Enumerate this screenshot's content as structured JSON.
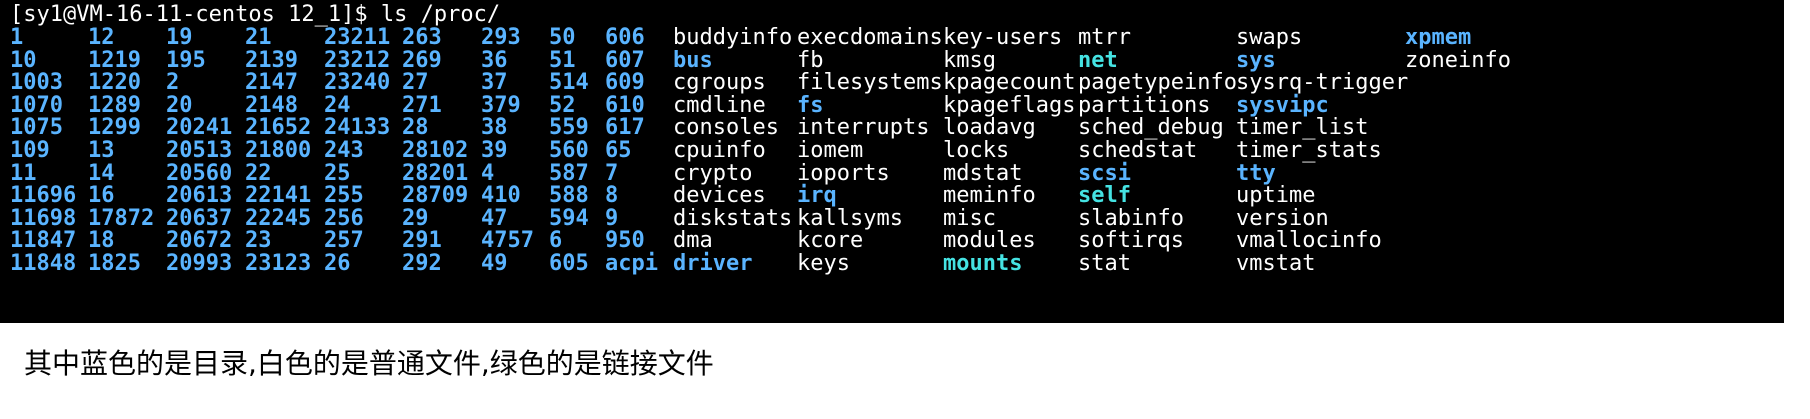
{
  "terminal": {
    "prompt": "[sy1@VM-16-11-centos 12_1]$ ls /proc/",
    "colors": {
      "background": "#000000",
      "file": "#ffffff",
      "directory": "#5ab4ff",
      "link": "#45e3e3"
    },
    "columns": [
      [
        {
          "name": "1",
          "kind": "dir"
        },
        {
          "name": "10",
          "kind": "dir"
        },
        {
          "name": "1003",
          "kind": "dir"
        },
        {
          "name": "1070",
          "kind": "dir"
        },
        {
          "name": "1075",
          "kind": "dir"
        },
        {
          "name": "109",
          "kind": "dir"
        },
        {
          "name": "11",
          "kind": "dir"
        },
        {
          "name": "11696",
          "kind": "dir"
        },
        {
          "name": "11698",
          "kind": "dir"
        },
        {
          "name": "11847",
          "kind": "dir"
        },
        {
          "name": "11848",
          "kind": "dir"
        }
      ],
      [
        {
          "name": "12",
          "kind": "dir"
        },
        {
          "name": "1219",
          "kind": "dir"
        },
        {
          "name": "1220",
          "kind": "dir"
        },
        {
          "name": "1289",
          "kind": "dir"
        },
        {
          "name": "1299",
          "kind": "dir"
        },
        {
          "name": "13",
          "kind": "dir"
        },
        {
          "name": "14",
          "kind": "dir"
        },
        {
          "name": "16",
          "kind": "dir"
        },
        {
          "name": "17872",
          "kind": "dir"
        },
        {
          "name": "18",
          "kind": "dir"
        },
        {
          "name": "1825",
          "kind": "dir"
        }
      ],
      [
        {
          "name": "19",
          "kind": "dir"
        },
        {
          "name": "195",
          "kind": "dir"
        },
        {
          "name": "2",
          "kind": "dir"
        },
        {
          "name": "20",
          "kind": "dir"
        },
        {
          "name": "20241",
          "kind": "dir"
        },
        {
          "name": "20513",
          "kind": "dir"
        },
        {
          "name": "20560",
          "kind": "dir"
        },
        {
          "name": "20613",
          "kind": "dir"
        },
        {
          "name": "20637",
          "kind": "dir"
        },
        {
          "name": "20672",
          "kind": "dir"
        },
        {
          "name": "20993",
          "kind": "dir"
        }
      ],
      [
        {
          "name": "21",
          "kind": "dir"
        },
        {
          "name": "2139",
          "kind": "dir"
        },
        {
          "name": "2147",
          "kind": "dir"
        },
        {
          "name": "2148",
          "kind": "dir"
        },
        {
          "name": "21652",
          "kind": "dir"
        },
        {
          "name": "21800",
          "kind": "dir"
        },
        {
          "name": "22",
          "kind": "dir"
        },
        {
          "name": "22141",
          "kind": "dir"
        },
        {
          "name": "22245",
          "kind": "dir"
        },
        {
          "name": "23",
          "kind": "dir"
        },
        {
          "name": "23123",
          "kind": "dir"
        }
      ],
      [
        {
          "name": "23211",
          "kind": "dir"
        },
        {
          "name": "23212",
          "kind": "dir"
        },
        {
          "name": "23240",
          "kind": "dir"
        },
        {
          "name": "24",
          "kind": "dir"
        },
        {
          "name": "24133",
          "kind": "dir"
        },
        {
          "name": "243",
          "kind": "dir"
        },
        {
          "name": "25",
          "kind": "dir"
        },
        {
          "name": "255",
          "kind": "dir"
        },
        {
          "name": "256",
          "kind": "dir"
        },
        {
          "name": "257",
          "kind": "dir"
        },
        {
          "name": "26",
          "kind": "dir"
        }
      ],
      [
        {
          "name": "263",
          "kind": "dir"
        },
        {
          "name": "269",
          "kind": "dir"
        },
        {
          "name": "27",
          "kind": "dir"
        },
        {
          "name": "271",
          "kind": "dir"
        },
        {
          "name": "28",
          "kind": "dir"
        },
        {
          "name": "28102",
          "kind": "dir"
        },
        {
          "name": "28201",
          "kind": "dir"
        },
        {
          "name": "28709",
          "kind": "dir"
        },
        {
          "name": "29",
          "kind": "dir"
        },
        {
          "name": "291",
          "kind": "dir"
        },
        {
          "name": "292",
          "kind": "dir"
        }
      ],
      [
        {
          "name": "293",
          "kind": "dir"
        },
        {
          "name": "36",
          "kind": "dir"
        },
        {
          "name": "37",
          "kind": "dir"
        },
        {
          "name": "379",
          "kind": "dir"
        },
        {
          "name": "38",
          "kind": "dir"
        },
        {
          "name": "39",
          "kind": "dir"
        },
        {
          "name": "4",
          "kind": "dir"
        },
        {
          "name": "410",
          "kind": "dir"
        },
        {
          "name": "47",
          "kind": "dir"
        },
        {
          "name": "4757",
          "kind": "dir"
        },
        {
          "name": "49",
          "kind": "dir"
        }
      ],
      [
        {
          "name": "50",
          "kind": "dir"
        },
        {
          "name": "51",
          "kind": "dir"
        },
        {
          "name": "514",
          "kind": "dir"
        },
        {
          "name": "52",
          "kind": "dir"
        },
        {
          "name": "559",
          "kind": "dir"
        },
        {
          "name": "560",
          "kind": "dir"
        },
        {
          "name": "587",
          "kind": "dir"
        },
        {
          "name": "588",
          "kind": "dir"
        },
        {
          "name": "594",
          "kind": "dir"
        },
        {
          "name": "6",
          "kind": "dir"
        },
        {
          "name": "605",
          "kind": "dir"
        }
      ],
      [
        {
          "name": "606",
          "kind": "dir"
        },
        {
          "name": "607",
          "kind": "dir"
        },
        {
          "name": "609",
          "kind": "dir"
        },
        {
          "name": "610",
          "kind": "dir"
        },
        {
          "name": "617",
          "kind": "dir"
        },
        {
          "name": "65",
          "kind": "dir"
        },
        {
          "name": "7",
          "kind": "dir"
        },
        {
          "name": "8",
          "kind": "dir"
        },
        {
          "name": "9",
          "kind": "dir"
        },
        {
          "name": "950",
          "kind": "dir"
        },
        {
          "name": "acpi",
          "kind": "dir"
        }
      ],
      [
        {
          "name": "buddyinfo",
          "kind": "file"
        },
        {
          "name": "bus",
          "kind": "dir"
        },
        {
          "name": "cgroups",
          "kind": "file"
        },
        {
          "name": "cmdline",
          "kind": "file"
        },
        {
          "name": "consoles",
          "kind": "file"
        },
        {
          "name": "cpuinfo",
          "kind": "file"
        },
        {
          "name": "crypto",
          "kind": "file"
        },
        {
          "name": "devices",
          "kind": "file"
        },
        {
          "name": "diskstats",
          "kind": "file"
        },
        {
          "name": "dma",
          "kind": "file"
        },
        {
          "name": "driver",
          "kind": "dir"
        }
      ],
      [
        {
          "name": "execdomains",
          "kind": "file"
        },
        {
          "name": "fb",
          "kind": "file"
        },
        {
          "name": "filesystems",
          "kind": "file"
        },
        {
          "name": "fs",
          "kind": "dir"
        },
        {
          "name": "interrupts",
          "kind": "file"
        },
        {
          "name": "iomem",
          "kind": "file"
        },
        {
          "name": "ioports",
          "kind": "file"
        },
        {
          "name": "irq",
          "kind": "dir"
        },
        {
          "name": "kallsyms",
          "kind": "file"
        },
        {
          "name": "kcore",
          "kind": "file"
        },
        {
          "name": "keys",
          "kind": "file"
        }
      ],
      [
        {
          "name": "key-users",
          "kind": "file"
        },
        {
          "name": "kmsg",
          "kind": "file"
        },
        {
          "name": "kpagecount",
          "kind": "file"
        },
        {
          "name": "kpageflags",
          "kind": "file"
        },
        {
          "name": "loadavg",
          "kind": "file"
        },
        {
          "name": "locks",
          "kind": "file"
        },
        {
          "name": "mdstat",
          "kind": "file"
        },
        {
          "name": "meminfo",
          "kind": "file"
        },
        {
          "name": "misc",
          "kind": "file"
        },
        {
          "name": "modules",
          "kind": "file"
        },
        {
          "name": "mounts",
          "kind": "link"
        }
      ],
      [
        {
          "name": "mtrr",
          "kind": "file"
        },
        {
          "name": "net",
          "kind": "link"
        },
        {
          "name": "pagetypeinfo",
          "kind": "file"
        },
        {
          "name": "partitions",
          "kind": "file"
        },
        {
          "name": "sched_debug",
          "kind": "file"
        },
        {
          "name": "schedstat",
          "kind": "file"
        },
        {
          "name": "scsi",
          "kind": "dir"
        },
        {
          "name": "self",
          "kind": "link"
        },
        {
          "name": "slabinfo",
          "kind": "file"
        },
        {
          "name": "softirqs",
          "kind": "file"
        },
        {
          "name": "stat",
          "kind": "file"
        }
      ],
      [
        {
          "name": "swaps",
          "kind": "file"
        },
        {
          "name": "sys",
          "kind": "dir"
        },
        {
          "name": "sysrq-trigger",
          "kind": "file"
        },
        {
          "name": "sysvipc",
          "kind": "dir"
        },
        {
          "name": "timer_list",
          "kind": "file"
        },
        {
          "name": "timer_stats",
          "kind": "file"
        },
        {
          "name": "tty",
          "kind": "dir"
        },
        {
          "name": "uptime",
          "kind": "file"
        },
        {
          "name": "version",
          "kind": "file"
        },
        {
          "name": "vmallocinfo",
          "kind": "file"
        },
        {
          "name": "vmstat",
          "kind": "file"
        }
      ],
      [
        {
          "name": "xpmem",
          "kind": "dir"
        },
        {
          "name": "zoneinfo",
          "kind": "file"
        }
      ]
    ]
  },
  "caption": "其中蓝色的是目录,白色的是普通文件,绿色的是链接文件"
}
